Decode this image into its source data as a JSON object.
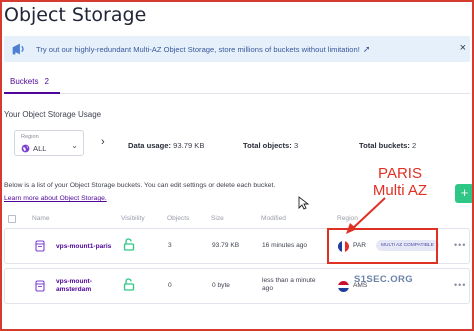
{
  "page": {
    "title": "Object Storage"
  },
  "banner": {
    "text": "Try out our highly-redundant Multi-AZ Object Storage, store millions of buckets without limitation!",
    "icon": "megaphone-icon"
  },
  "tabs": [
    {
      "label": "Buckets",
      "count": "2"
    }
  ],
  "usage": {
    "title": "Your Object Storage Usage",
    "region_label": "Region",
    "region_value": "ALL",
    "data_usage_label": "Data usage:",
    "data_usage_value": "93.79 KB",
    "total_objects_label": "Total objects:",
    "total_objects_value": "3",
    "total_buckets_label": "Total buckets:",
    "total_buckets_value": "2"
  },
  "help_text": "Below is a list of your Object Storage buckets. You can edit settings or delete each bucket.",
  "learn_more": "Learn more about Object Storage.",
  "add_button": "+",
  "table": {
    "headers": [
      "Name",
      "Visibility",
      "Objects",
      "Size",
      "Modified",
      "Region"
    ],
    "rows": [
      {
        "name": "vps-mount1-paris",
        "objects": "3",
        "size": "93.79 KB",
        "modified": "16 minutes ago",
        "region": "PAR",
        "badge": "MULTI AZ COMPATIBLE",
        "flag": "france-flag"
      },
      {
        "name_line1": "vps-mount-",
        "name_line2": "amsterdam",
        "objects": "0",
        "size": "0 byte",
        "modified_line1": "less than a minute",
        "modified_line2": "ago",
        "region": "AMS",
        "flag": "netherlands-flag"
      }
    ]
  },
  "annotation": {
    "line1": "PARIS",
    "line2": "Multi AZ"
  },
  "watermark": "S1SEC.ORG",
  "colors": {
    "brand": "#4f0599",
    "accent_green": "#2fc786",
    "annotation_red": "#e03024",
    "banner_bg": "#e6f0fb"
  }
}
